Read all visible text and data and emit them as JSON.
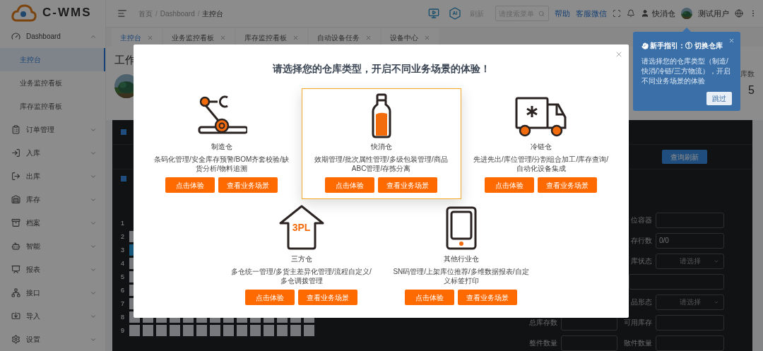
{
  "header": {
    "logo": "C-WMS",
    "breadcrumb": [
      "首页",
      "Dashboard",
      "主控台"
    ],
    "breadcrumb_separator": "/",
    "ai_badge": "AI",
    "refresh": "刷新",
    "search": {
      "placeholder": "请搜索菜单"
    },
    "links": [
      "帮助",
      "客服微信"
    ],
    "warehouse": "快消仓",
    "user": "测试用户"
  },
  "sidebar": {
    "items": [
      {
        "label": "Dashboard",
        "expanded": true,
        "children": [
          {
            "label": "主控台",
            "selected": true
          },
          {
            "label": "业务监控看板",
            "selected": false
          },
          {
            "label": "库存监控看板",
            "selected": false
          }
        ]
      },
      {
        "label": "订单管理",
        "expanded": false
      },
      {
        "label": "入库",
        "expanded": false
      },
      {
        "label": "出库",
        "expanded": false
      },
      {
        "label": "库存",
        "expanded": false
      },
      {
        "label": "档案",
        "expanded": false
      },
      {
        "label": "智能",
        "expanded": false
      },
      {
        "label": "报表",
        "expanded": false
      },
      {
        "label": "接口",
        "expanded": false
      },
      {
        "label": "导入",
        "expanded": false
      },
      {
        "label": "设置",
        "expanded": false
      }
    ]
  },
  "tabs": [
    {
      "label": "主控台",
      "selected": true
    },
    {
      "label": "业务监控看板",
      "selected": false
    },
    {
      "label": "库存监控看板",
      "selected": false
    },
    {
      "label": "自动设备任务",
      "selected": false
    },
    {
      "label": "设备中心",
      "selected": false
    }
  ],
  "page": {
    "title": "工作",
    "stat_label": "库数",
    "stat_value": "5"
  },
  "panel": {
    "button": "查询刷新",
    "grid_rows": [
      {
        "label": "1"
      },
      {
        "label": "2",
        "highlighted": false
      },
      {
        "label": "3",
        "highlighted": true
      },
      {
        "label": "4",
        "highlighted": false
      },
      {
        "label": "5",
        "highlighted": false
      },
      {
        "label": "6",
        "highlighted": false
      },
      {
        "label": "7",
        "highlighted": false
      },
      {
        "label": "8",
        "highlighted": false
      },
      {
        "label": "9",
        "highlighted": false
      }
    ],
    "fields": [
      {
        "kind": "input",
        "label": "位容器"
      },
      {
        "kind": "input",
        "label": "存行数",
        "value": "0/0"
      },
      {
        "kind": "select",
        "label": "库状态",
        "placeholder": "请选择"
      },
      {
        "kind": "wide"
      },
      {
        "kind": "select",
        "label": "品形态",
        "placeholder": "请选择"
      },
      {
        "kind": "pair",
        "left_label": "总库存数",
        "label": "可用库存"
      },
      {
        "kind": "pair",
        "left_label": "整件数量",
        "label": "散件数量"
      }
    ]
  },
  "modal": {
    "title": "请选择您的仓库类型，开启不同业务场景的体验！",
    "cards": [
      {
        "kind": "robot",
        "name": "制造仓",
        "description": "条码化管理/安全库存预警/BOM齐套校验/缺货分析/物料追溯",
        "selected": false,
        "buttons": [
          "点击体验",
          "查看业务场景"
        ]
      },
      {
        "kind": "bottle",
        "name": "快消仓",
        "description": "效期管理/批次属性管理/多级包装管理/商品ABC管理/存拣分离",
        "selected": true,
        "buttons": [
          "点击体验",
          "查看业务场景"
        ]
      },
      {
        "kind": "truck",
        "name": "冷链仓",
        "description": "先进先出/库位管理/分割组合加工/库存查询/自动化设备集成",
        "selected": false,
        "buttons": [
          "点击体验",
          "查看业务场景"
        ]
      },
      {
        "kind": "house",
        "icon_text": "3PL",
        "name": "三方仓",
        "description": "多仓统一管理/多货主差异化管理/流程自定义/多仓调拨管理",
        "selected": false,
        "buttons": [
          "点击体验",
          "查看业务场景"
        ]
      },
      {
        "kind": "tablet",
        "name": "其他行业仓",
        "description": "SN码管理/上架库位推荐/多维数据报表/自定义标签打印",
        "selected": false,
        "buttons": [
          "点击体验",
          "查看业务场景"
        ]
      }
    ]
  },
  "guide": {
    "title": "新手指引：① 切换仓库",
    "text": "请选择您的仓库类型（制造/快消/冷链/三方物流），开启不同业务场景的体验",
    "button": "跳过"
  }
}
